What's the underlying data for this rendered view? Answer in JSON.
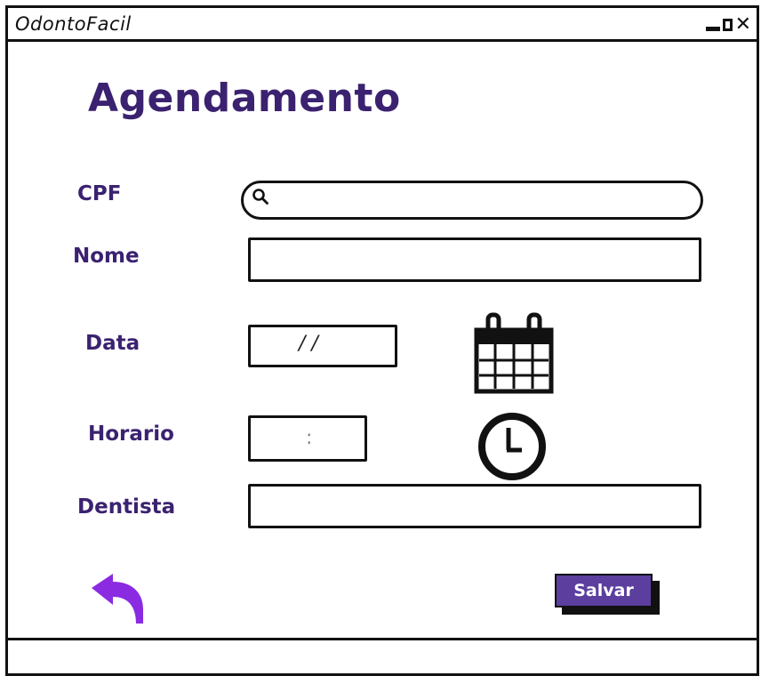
{
  "window": {
    "title": "OdontoFacil",
    "controls": {
      "minimize": "minimize",
      "maximize": "maximize",
      "close": "✕"
    }
  },
  "page": {
    "title": "Agendamento"
  },
  "form": {
    "cpf": {
      "label": "CPF",
      "value": "",
      "placeholder": ""
    },
    "nome": {
      "label": "Nome",
      "value": "",
      "placeholder": ""
    },
    "data": {
      "label": "Data",
      "mask": "/   /"
    },
    "horario": {
      "label": "Horario",
      "mask": ":"
    },
    "dentista": {
      "label": "Dentista",
      "value": "",
      "placeholder": ""
    }
  },
  "icons": {
    "search": "search-icon",
    "calendar": "calendar-icon",
    "clock": "clock-icon",
    "back": "back-arrow-icon"
  },
  "actions": {
    "save_label": "Salvar"
  },
  "colors": {
    "brand": "#3b2270",
    "button": "#5b3e9e",
    "back_arrow": "#8a2be2"
  }
}
